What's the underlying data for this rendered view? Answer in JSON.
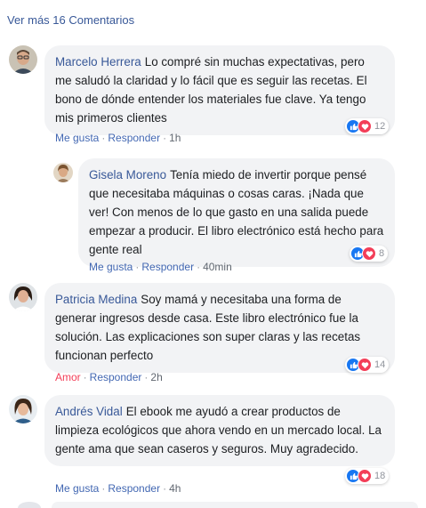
{
  "view_more_label": "Ver más 16 Comentarios",
  "colors": {
    "link": "#385898",
    "action": "#4267b2",
    "bubble": "#f2f3f5",
    "like": "#1877f2",
    "love": "#f33e58",
    "meta": "#606770"
  },
  "comments": [
    {
      "author": "Marcelo Herrera",
      "text": "Lo compré sin muchas expectativas, pero me saludó la claridad y lo fácil que es seguir las recetas. El bono de dónde entender los materiales fue clave. Ya tengo mis primeros clientes",
      "action_label": "Me gusta",
      "reply_label": "Responder",
      "time": "1h",
      "reaction_icons": [
        "like-icon",
        "love-icon"
      ],
      "reaction_count": "12"
    },
    {
      "author": "Gisela Moreno",
      "text": "Tenía miedo de invertir porque pensé que necesitaba máquinas o cosas caras. ¡Nada que ver! Con menos de lo que gasto en una salida puede empezar a producir. El libro electrónico está hecho para gente real",
      "action_label": "Me gusta",
      "reply_label": "Responder",
      "time": "40min",
      "reaction_icons": [
        "like-icon",
        "love-icon"
      ],
      "reaction_count": "8"
    },
    {
      "author": "Patricia Medina",
      "text": "Soy mamá y necesitaba una forma de generar ingresos desde casa. Este libro electrónico fue la solución. Las explicaciones son super claras y las recetas funcionan perfecto",
      "action_label": "Amor",
      "action_color": "#f33e58",
      "reply_label": "Responder",
      "time": "2h",
      "reaction_icons": [
        "like-icon",
        "love-icon"
      ],
      "reaction_count": "14"
    },
    {
      "author": "Andrés Vidal",
      "text": "El ebook me ayudó a crear productos de limpieza ecológicos que ahora vendo en un mercado local. La gente ama que sean caseros y seguros. Muy agradecido.",
      "action_label": "Me gusta",
      "reply_label": "Responder",
      "time": "4h",
      "reaction_icons": [
        "like-icon",
        "love-icon"
      ],
      "reaction_count": "18"
    }
  ]
}
